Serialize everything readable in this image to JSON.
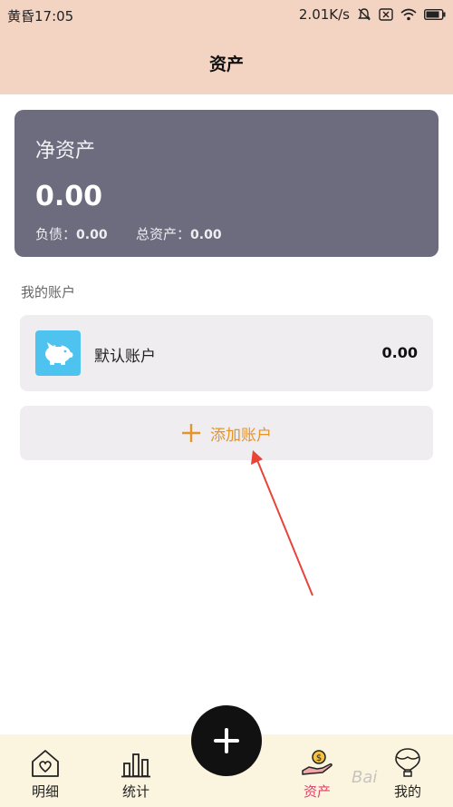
{
  "status_bar": {
    "time": "黄昏17:05",
    "speed": "2.01K/s"
  },
  "header": {
    "title": "资产"
  },
  "net_asset_card": {
    "label": "净资产",
    "value": "0.00",
    "liabilities_label": "负债：",
    "liabilities_value": "0.00",
    "total_assets_label": "总资产：",
    "total_assets_value": "0.00"
  },
  "accounts_section": {
    "label": "我的账户",
    "accounts": [
      {
        "name": "默认账户",
        "balance": "0.00",
        "icon": "piggy-bank-icon"
      }
    ],
    "add_label": "添加账户"
  },
  "tabbar": {
    "tabs": [
      {
        "label": "明细",
        "icon": "heart-house-icon"
      },
      {
        "label": "统计",
        "icon": "bar-chart-icon"
      },
      {
        "label": "资产",
        "icon": "coin-hand-icon",
        "active": true
      },
      {
        "label": "我的",
        "icon": "balloon-icon"
      }
    ],
    "fab_icon": "plus-icon"
  },
  "colors": {
    "header_bg": "#f3d3c2",
    "card_bg": "#6d6b7e",
    "accent_orange": "#e6942a",
    "active_tab": "#e0406a",
    "tabbar_bg": "#fbf4df",
    "arrow": "#e8443a"
  },
  "watermark": "Bai"
}
